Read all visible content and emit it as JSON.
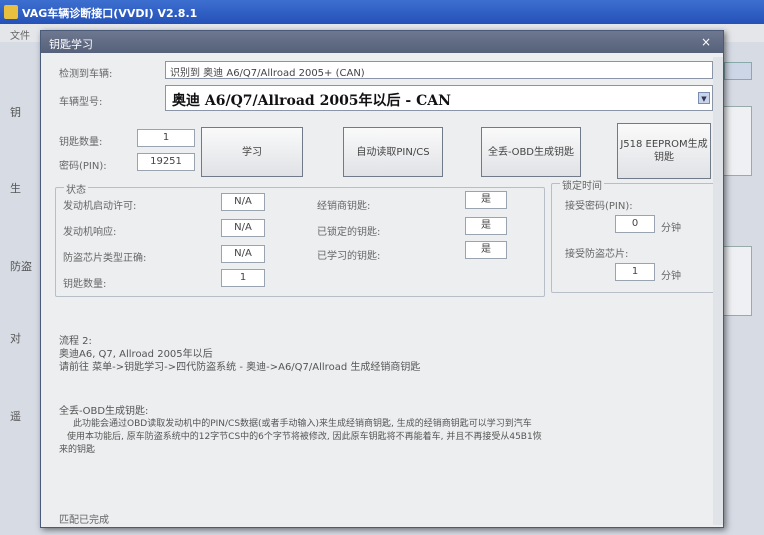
{
  "app": {
    "title": "VAG车辆诊断接口(VVDI)  V2.8.1",
    "menu": "文件",
    "side_labels": [
      "钥",
      "生",
      "防盗",
      "对",
      "遥"
    ]
  },
  "dialog": {
    "title": "钥匙学习",
    "close_icon": "×",
    "vehicle_label": "检测到车辆:",
    "vehicle_value": "识别到 奥迪 A6/Q7/Allroad 2005+ (CAN)",
    "type_label": "车辆型号:",
    "type_value": "奥迪 A6/Q7/Allroad 2005年以后 - CAN",
    "key_count_label": "钥匙数量:",
    "key_count_value": "1",
    "pin_label": "密码(PIN):",
    "pin_value": "19251",
    "buttons": {
      "learn": "学习",
      "auto_pin": "自动读取PIN/CS",
      "obd_gen": "全丢-OBD生成钥匙",
      "eeprom_gen": "J518 EEPROM生成钥匙"
    },
    "status": {
      "title": "状态",
      "engine_start_label": "发动机启动许可:",
      "engine_start_value": "N/A",
      "engine_resp_label": "发动机响应:",
      "engine_resp_value": "N/A",
      "chip_type_label": "防盗芯片类型正确:",
      "chip_type_value": "N/A",
      "key_count_label": "钥匙数量:",
      "key_count_value": "1",
      "dealer_key_label": "经销商钥匙:",
      "dealer_key_value": "是",
      "locked_key_label": "已锁定的钥匙:",
      "locked_key_value": "是",
      "learned_key_label": "已学习的钥匙:",
      "learned_key_value": "是"
    },
    "lock_time": {
      "title": "锁定时间",
      "accept_pin_label": "接受密码(PIN):",
      "accept_pin_value": "0",
      "accept_pin_unit": "分钟",
      "accept_chip_label": "接受防盗芯片:",
      "accept_chip_value": "1",
      "accept_chip_unit": "分钟"
    },
    "info": {
      "line1": "流程 2:",
      "line2": "奥迪A6, Q7, Allroad 2005年以后",
      "line3": "请前往 菜单->钥匙学习->四代防盗系统 - 奥迪->A6/Q7/Allroad 生成经销商钥匙",
      "line4": "全丢-OBD生成钥匙:",
      "line5": "此功能会通过OBD读取发动机中的PIN/CS数据(或者手动输入)来生成经销商钥匙, 生成的经销商钥匙可以学习到汽车",
      "line6": "使用本功能后, 原车防盗系统中的12字节CS中的6个字节将被修改, 因此原车钥匙将不再能着车, 并且不再接受从45B1恢",
      "line7": "来的钥匙"
    },
    "status_bar": "匹配已完成"
  }
}
